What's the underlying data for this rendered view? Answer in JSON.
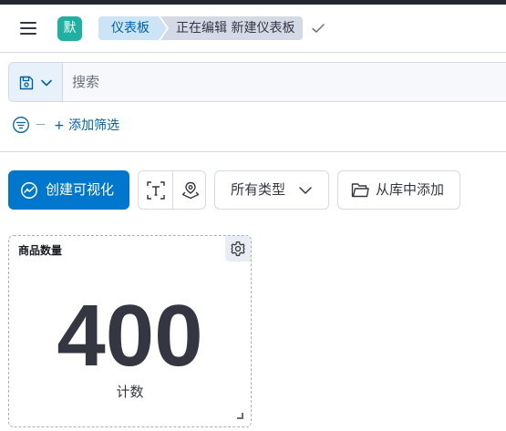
{
  "header": {
    "space_avatar_letter": "默",
    "breadcrumbs": [
      {
        "label": "仪表板"
      },
      {
        "label": "正在编辑 新建仪表板"
      }
    ]
  },
  "query_bar": {
    "search_placeholder": "搜索",
    "add_filter_label": "+ 添加筛选"
  },
  "toolbar": {
    "create_label": "创建可视化",
    "types_label": "所有类型",
    "library_label": "从库中添加"
  },
  "panels": [
    {
      "title": "商品数量",
      "metric_value": "400",
      "metric_label": "计数"
    }
  ],
  "colors": {
    "primary": "#0077cc",
    "breadcrumb_active_bg": "#cce4f5",
    "breadcrumb_current_bg": "#d3dae6",
    "space_avatar": "#1fb0a1"
  }
}
